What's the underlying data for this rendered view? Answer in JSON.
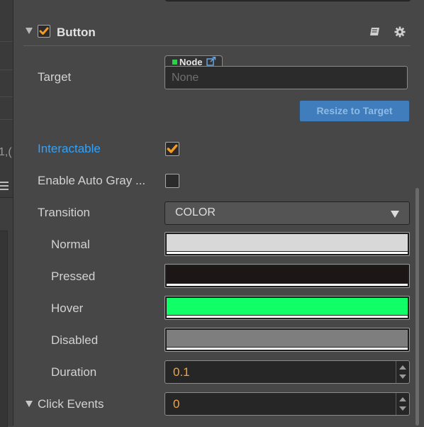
{
  "left_strip": {
    "partial_number": "1,("
  },
  "component": {
    "title": "Button",
    "enabled": true,
    "icons": [
      "book-icon",
      "gear-icon"
    ]
  },
  "target": {
    "label": "Target",
    "type_tab": "Node",
    "value": "None",
    "resize_button": "Resize to Target"
  },
  "interactable": {
    "label": "Interactable",
    "checked": true,
    "label_color": "#2ea3ff"
  },
  "auto_gray": {
    "label": "Enable Auto Gray ...",
    "checked": false
  },
  "transition": {
    "label": "Transition",
    "value": "COLOR"
  },
  "colors": {
    "normal": {
      "label": "Normal",
      "color": "#d8d8d8"
    },
    "pressed": {
      "label": "Pressed",
      "color": "#1c1616"
    },
    "hover": {
      "label": "Hover",
      "color": "#10ff66"
    },
    "disabled": {
      "label": "Disabled",
      "color": "#7e7e7e"
    }
  },
  "duration": {
    "label": "Duration",
    "value": "0.1"
  },
  "click_events": {
    "label": "Click Events",
    "value": "0"
  },
  "accent_colors": {
    "checkmark": "#f59a23",
    "number_text": "#f7a23b",
    "button": "#3f7dbd"
  }
}
